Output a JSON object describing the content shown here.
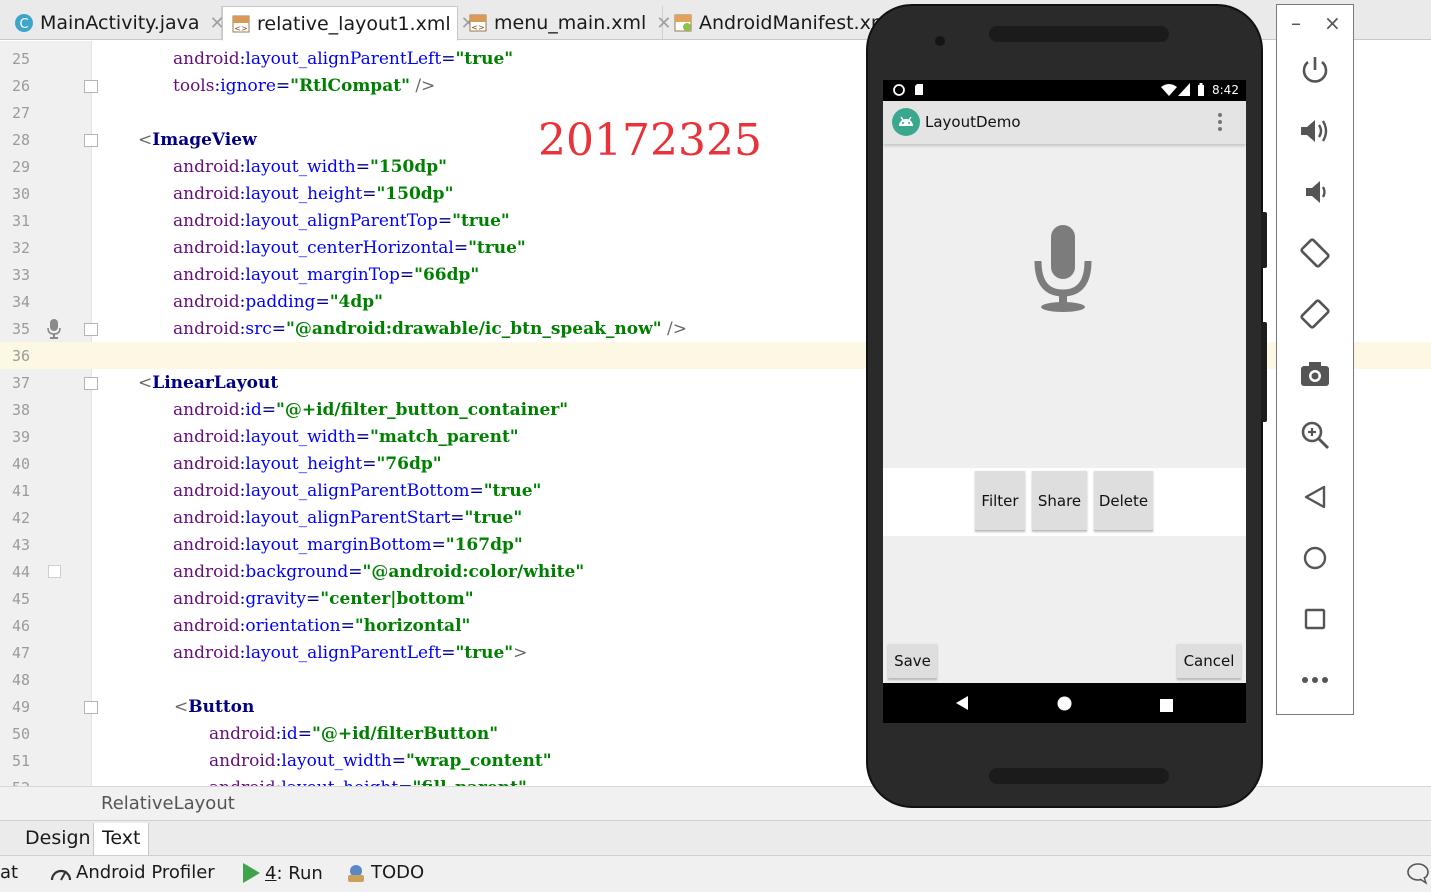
{
  "editor_tabs": [
    {
      "label": "MainActivity.java",
      "icon": "java-class-icon",
      "active": false
    },
    {
      "label": "relative_layout1.xml",
      "icon": "layout-xml-icon",
      "active": true
    },
    {
      "label": "menu_main.xml",
      "icon": "layout-xml-icon",
      "active": false
    },
    {
      "label": "AndroidManifest.xml",
      "icon": "manifest-icon",
      "active": false
    }
  ],
  "code_lines": [
    {
      "n": "25",
      "text": "android:layout_alignParentLeft=\"true\""
    },
    {
      "n": "26",
      "text": "tools:ignore=\"RtlCompat\" />"
    },
    {
      "n": "27",
      "text": ""
    },
    {
      "n": "28",
      "text": "<ImageView"
    },
    {
      "n": "29",
      "text": "android:layout_width=\"150dp\""
    },
    {
      "n": "30",
      "text": "android:layout_height=\"150dp\""
    },
    {
      "n": "31",
      "text": "android:layout_alignParentTop=\"true\""
    },
    {
      "n": "32",
      "text": "android:layout_centerHorizontal=\"true\""
    },
    {
      "n": "33",
      "text": "android:layout_marginTop=\"66dp\""
    },
    {
      "n": "34",
      "text": "android:padding=\"4dp\""
    },
    {
      "n": "35",
      "text": "android:src=\"@android:drawable/ic_btn_speak_now\" />"
    },
    {
      "n": "36",
      "text": ""
    },
    {
      "n": "37",
      "text": "<LinearLayout"
    },
    {
      "n": "38",
      "text": "android:id=\"@+id/filter_button_container\""
    },
    {
      "n": "39",
      "text": "android:layout_width=\"match_parent\""
    },
    {
      "n": "40",
      "text": "android:layout_height=\"76dp\""
    },
    {
      "n": "41",
      "text": "android:layout_alignParentBottom=\"true\""
    },
    {
      "n": "42",
      "text": "android:layout_alignParentStart=\"true\""
    },
    {
      "n": "43",
      "text": "android:layout_marginBottom=\"167dp\""
    },
    {
      "n": "44",
      "text": "android:background=\"@android:color/white\""
    },
    {
      "n": "45",
      "text": "android:gravity=\"center|bottom\""
    },
    {
      "n": "46",
      "text": "android:orientation=\"horizontal\""
    },
    {
      "n": "47",
      "text": "android:layout_alignParentLeft=\"true\">"
    },
    {
      "n": "48",
      "text": ""
    },
    {
      "n": "49",
      "text": "<Button"
    },
    {
      "n": "50",
      "text": "android:id=\"@+id/filterButton\""
    },
    {
      "n": "51",
      "text": "android:layout_width=\"wrap_content\""
    },
    {
      "n": "52",
      "text": "android:layout_height=\"fill_parent\""
    }
  ],
  "watermark": "20172325",
  "breadcrumb": "RelativeLayout",
  "design_tabs": {
    "design": "Design",
    "text": "Text"
  },
  "toolbar": {
    "cut_left": "at",
    "profiler": "Android Profiler",
    "run_number": "4",
    "run_label": ": Run",
    "todo": "TODO"
  },
  "phone": {
    "status_time": "8:42",
    "app_title": "LayoutDemo",
    "buttons": {
      "filter": "Filter",
      "share": "Share",
      "delete": "Delete",
      "save": "Save",
      "cancel": "Cancel"
    }
  },
  "side_panel": {
    "minimize": "–",
    "close": "×",
    "icons": [
      "power-icon",
      "volume-up-icon",
      "volume-down-icon",
      "rotate-left-icon",
      "rotate-right-icon",
      "camera-icon",
      "zoom-icon",
      "back-icon",
      "home-icon",
      "overview-icon",
      "more-icon"
    ]
  },
  "colors": {
    "xml_tag": "#000080",
    "xml_value": "#008000",
    "namespace": "#660e7a",
    "watermark": "#e8333a",
    "current_line": "#fcf8e3"
  }
}
